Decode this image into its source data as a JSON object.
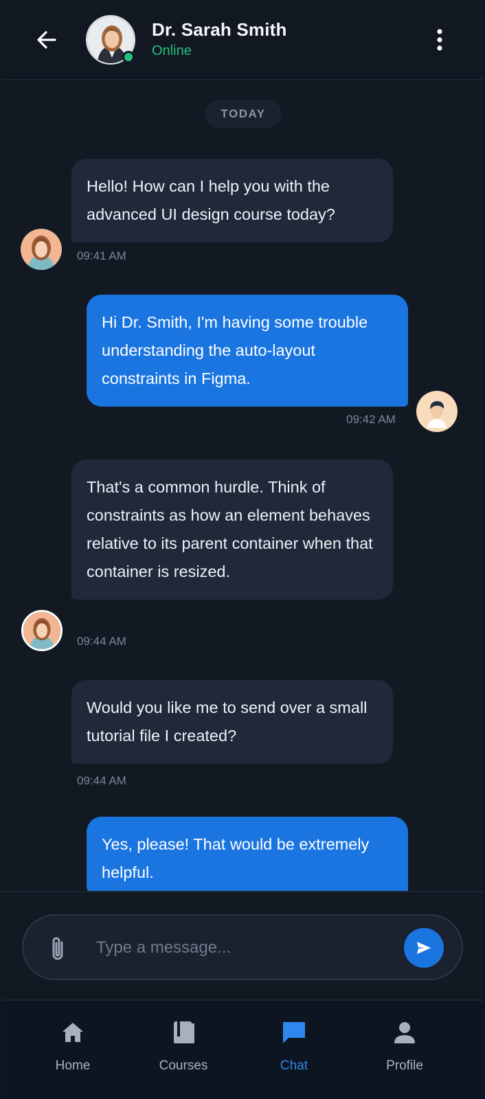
{
  "header": {
    "contact_name": "Dr. Sarah Smith",
    "contact_status": "Online",
    "back_icon": "arrow-left-icon",
    "more_icon": "more-vertical-icon"
  },
  "chat": {
    "day_label": "TODAY",
    "messages": [
      {
        "sender": "instructor",
        "text": "Hello! How can I help you with the advanced UI design course today?",
        "time": "09:41 AM"
      },
      {
        "sender": "user",
        "text": "Hi Dr. Smith, I'm having some trouble understanding the auto-layout constraints in Figma.",
        "time": "09:42 AM"
      },
      {
        "sender": "instructor",
        "text": "That's a common hurdle. Think of constraints as how an element behaves relative to its parent container when that container is resized.",
        "time": "09:44 AM"
      },
      {
        "sender": "instructor",
        "text": "Would you like me to send over a small tutorial file I created?",
        "time": "09:44 AM"
      },
      {
        "sender": "user",
        "text": "Yes, please! That would be extremely helpful.",
        "time": ""
      }
    ]
  },
  "composer": {
    "placeholder": "Type a message...",
    "value": "",
    "attach_icon": "paperclip-icon",
    "send_icon": "send-icon"
  },
  "nav": {
    "items": [
      {
        "label": "Home",
        "icon": "home-icon",
        "active": false
      },
      {
        "label": "Courses",
        "icon": "book-icon",
        "active": false
      },
      {
        "label": "Chat",
        "icon": "chat-icon",
        "active": true
      },
      {
        "label": "Profile",
        "icon": "person-icon",
        "active": false
      }
    ]
  },
  "colors": {
    "background": "#121922",
    "incoming_bubble": "#1f293a",
    "outgoing_bubble": "#1a75e0",
    "online": "#22c07a",
    "active_nav": "#2f86ee"
  }
}
